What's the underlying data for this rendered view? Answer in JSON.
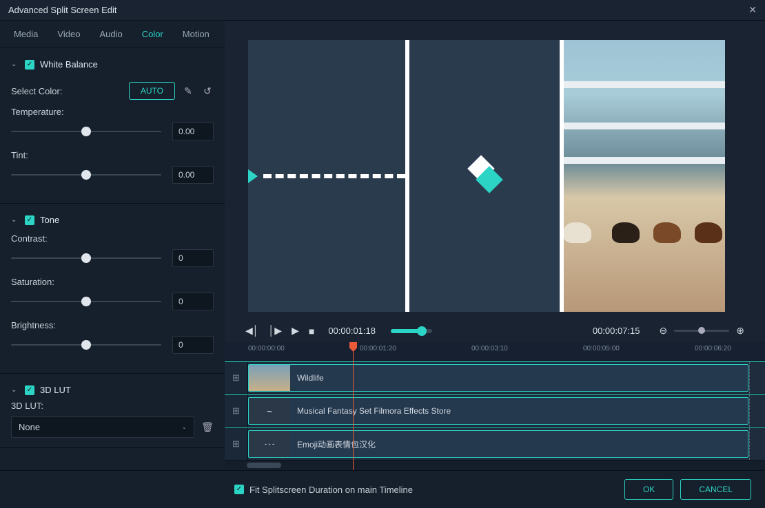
{
  "window": {
    "title": "Advanced Split Screen Edit"
  },
  "tabs": [
    "Media",
    "Video",
    "Audio",
    "Color",
    "Motion"
  ],
  "active_tab": "Color",
  "sections": {
    "white_balance": {
      "title": "White Balance",
      "select_color_label": "Select Color:",
      "auto_label": "AUTO",
      "temperature_label": "Temperature:",
      "temperature_value": "0.00",
      "tint_label": "Tint:",
      "tint_value": "0.00"
    },
    "tone": {
      "title": "Tone",
      "contrast_label": "Contrast:",
      "contrast_value": "0",
      "saturation_label": "Saturation:",
      "saturation_value": "0",
      "brightness_label": "Brightness:",
      "brightness_value": "0"
    },
    "lut": {
      "title": "3D LUT",
      "label": "3D LUT:",
      "selected": "None"
    }
  },
  "playback": {
    "current": "00:00:01:18",
    "duration": "00:00:07:15"
  },
  "ruler": [
    "00:00:00:00",
    "00:00:01:20",
    "00:00:03:10",
    "00:00:05:00",
    "00:00:06:20"
  ],
  "tracks": [
    {
      "label": "Wildlife"
    },
    {
      "label": "Musical Fantasy Set Filmora Effects Store"
    },
    {
      "label": "Emoji动画表情包汉化"
    }
  ],
  "footer": {
    "fit_label": "Fit Splitscreen Duration on main Timeline",
    "ok": "OK",
    "cancel": "CANCEL"
  }
}
